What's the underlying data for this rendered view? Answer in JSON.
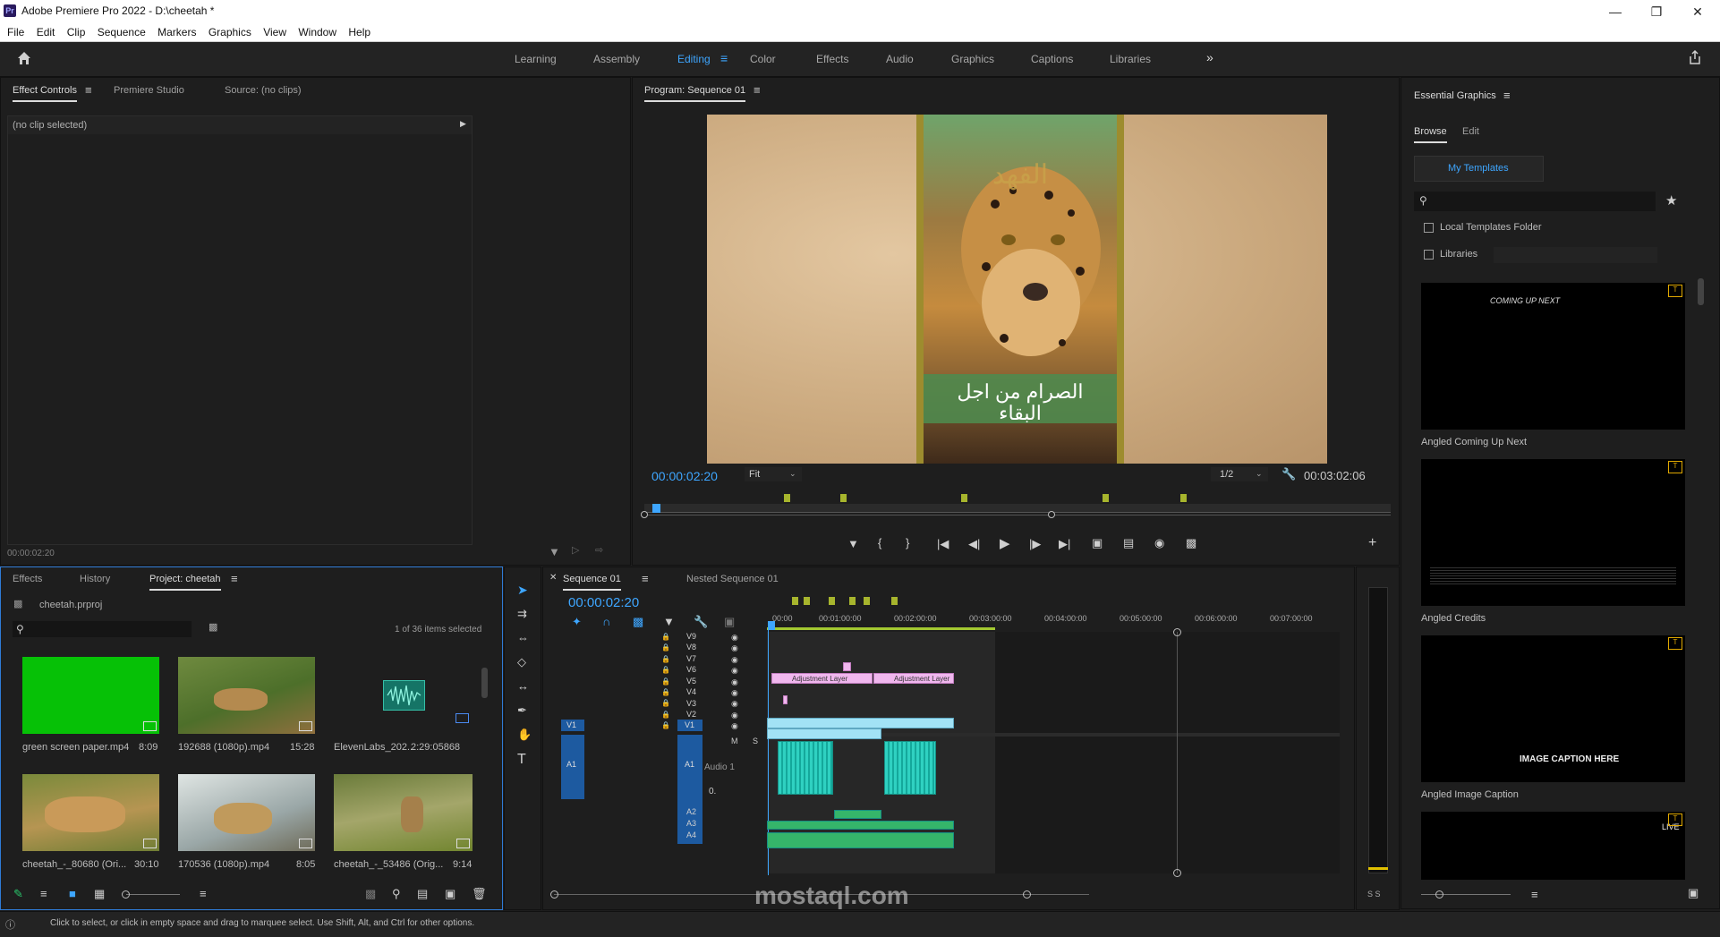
{
  "window": {
    "title": "Adobe Premiere Pro 2022 - D:\\cheetah *",
    "logo": "Pr"
  },
  "menu": [
    "File",
    "Edit",
    "Clip",
    "Sequence",
    "Markers",
    "Graphics",
    "View",
    "Window",
    "Help"
  ],
  "workspaces": [
    "Learning",
    "Assembly",
    "Editing",
    "Color",
    "Effects",
    "Audio",
    "Graphics",
    "Captions",
    "Libraries"
  ],
  "active_workspace": "Editing",
  "source_panel": {
    "tabs": [
      "Effect Controls",
      "Premiere Studio",
      "Source: (no clips)"
    ],
    "no_clip": "(no clip selected)",
    "timecode": "00:00:02:20"
  },
  "program": {
    "title": "Program: Sequence 01",
    "timecode": "00:00:02:20",
    "fit": "Fit",
    "resolution": "1/2",
    "duration": "00:03:02:06",
    "video_title": "الفهد",
    "caption_line1": "الصرام من اجل",
    "caption_line2": "البقاء"
  },
  "project": {
    "tabs": [
      "Effects",
      "History",
      "Project: cheetah"
    ],
    "file": "cheetah.prproj",
    "selection": "1 of 36 items selected",
    "items": [
      {
        "name": "green screen paper.mp4",
        "duration": "8:09"
      },
      {
        "name": "192688 (1080p).mp4",
        "duration": "15:28"
      },
      {
        "name": "ElevenLabs_202...",
        "duration": "2:29:05868"
      },
      {
        "name": "cheetah_-_80680 (Ori...",
        "duration": "30:10"
      },
      {
        "name": "170536 (1080p).mp4",
        "duration": "8:05"
      },
      {
        "name": "cheetah_-_53486 (Orig...",
        "duration": "9:14"
      }
    ]
  },
  "timeline": {
    "tabs": [
      "Sequence 01",
      "Nested Sequence 01"
    ],
    "timecode": "00:00:02:20",
    "ruler": [
      "00:00",
      "00:01:00:00",
      "00:02:00:00",
      "00:03:00:00",
      "00:04:00:00",
      "00:05:00:00",
      "00:06:00:00",
      "00:07:00:00"
    ],
    "video_tracks": [
      "V9",
      "V8",
      "V7",
      "V6",
      "V5",
      "V4",
      "V3",
      "V2",
      "V1"
    ],
    "audio_tracks": [
      "A1",
      "A2",
      "A3",
      "A4"
    ],
    "source_v": "V1",
    "source_a": "A1",
    "audio1_name": "Audio 1",
    "adjustment_label": "Adjustment Layer",
    "audio_level": "0.",
    "m": "M",
    "s": "S",
    "meter_label": "S S"
  },
  "essential_graphics": {
    "title": "Essential Graphics",
    "tabs": [
      "Browse",
      "Edit"
    ],
    "my_templates": "My Templates",
    "local_folder": "Local Templates Folder",
    "libraries": "Libraries",
    "templates": [
      {
        "name": "Angled Coming Up Next",
        "text": "COMING UP NEXT"
      },
      {
        "name": "Angled Credits",
        "text": ""
      },
      {
        "name": "Angled Image Caption",
        "text": "IMAGE CAPTION HERE"
      },
      {
        "name": "",
        "text": "LIVE"
      }
    ]
  },
  "status": "Click to select, or click in empty space and drag to marquee select. Use Shift, Alt, and Ctrl for other options.",
  "watermark": "mostaql.com",
  "colors": {
    "accent": "#3ea6ff",
    "panel": "#1e1e1e",
    "pink_clip": "#f0b7ee",
    "blue_clip": "#a2e2f5",
    "audio_clip": "#2fd1c1",
    "marker": "#a7b52d"
  }
}
